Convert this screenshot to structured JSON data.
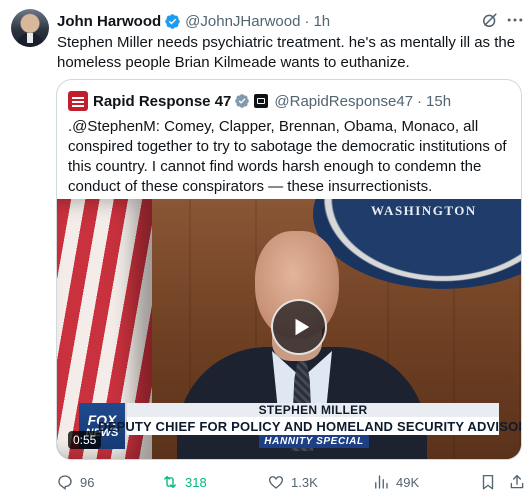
{
  "tweet": {
    "author_name": "John Harwood",
    "handle": "@JohnJHarwood",
    "separator": "·",
    "time": "1h",
    "text": "Stephen Miller needs psychiatric treatment. he's as mentally ill as the homeless people Brian Kilmeade wants to euthanize."
  },
  "quote": {
    "author_name": "Rapid Response 47",
    "handle": "@RapidResponse47",
    "separator": "·",
    "time": "15h",
    "text": ".@StephenM: Comey, Clapper, Brennan, Obama, Monaco, all conspired together to try to sabotage the democratic institutions of this country. I cannot find words harsh enough to condemn the conduct of these conspirators — these insurrectionists."
  },
  "video": {
    "seal_text": "WASHINGTON",
    "logo_top": "FOX",
    "logo_bottom": "NEWS",
    "lower_third_name": "STEPHEN MILLER",
    "lower_third_title": "DEPUTY CHIEF FOR POLICY AND HOMELAND SECURITY ADVISOR",
    "show_name": "HANNITY SPECIAL",
    "duration": "0:55"
  },
  "actions": {
    "replies": "96",
    "reposts": "318",
    "likes": "1.3K",
    "views": "49K"
  },
  "colors": {
    "verified_blue": "#1d9bf0",
    "verified_gold": "#e2b719",
    "repost_green": "#00ba7c",
    "muted_text": "#536471"
  },
  "icons": {
    "verified": "verified-badge-icon",
    "grok": "grok-icon",
    "more": "more-icon",
    "play": "play-icon",
    "reply": "reply-icon",
    "repost": "repost-icon",
    "like": "heart-icon",
    "views": "views-icon",
    "bookmark": "bookmark-icon",
    "share": "share-icon"
  }
}
